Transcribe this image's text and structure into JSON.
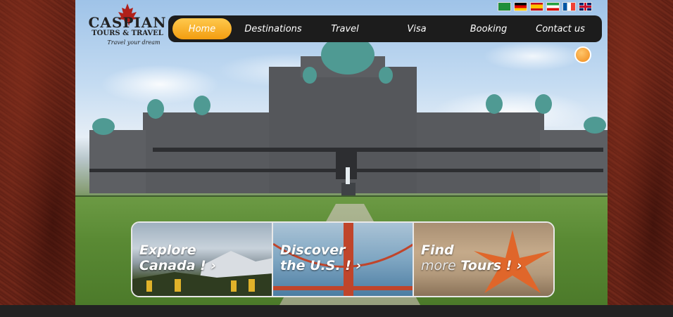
{
  "logo": {
    "name": "CASPIAN",
    "sub": "TOURS & TRAVEL",
    "tagline": "Travel your dream"
  },
  "languages": [
    "arabic-flag",
    "german-flag",
    "spanish-flag",
    "iran-flag",
    "french-flag",
    "uk-flag"
  ],
  "nav": {
    "items": [
      "Home",
      "Destinations",
      "Travel",
      "Visa",
      "Booking",
      "Contact us"
    ],
    "active_color": "#f7b22b"
  },
  "cards": [
    {
      "line1": "Explore",
      "line2": "Canada ! ›"
    },
    {
      "line1": "Discover",
      "line2": "the U.S. ! ›"
    },
    {
      "line1": "Find",
      "line2_muted": "more",
      "line2_main": " Tours ! ›"
    }
  ],
  "colors": {
    "background": "#5f2015",
    "nav_bar": "#1c1c1c",
    "accent": "#f29d10"
  }
}
